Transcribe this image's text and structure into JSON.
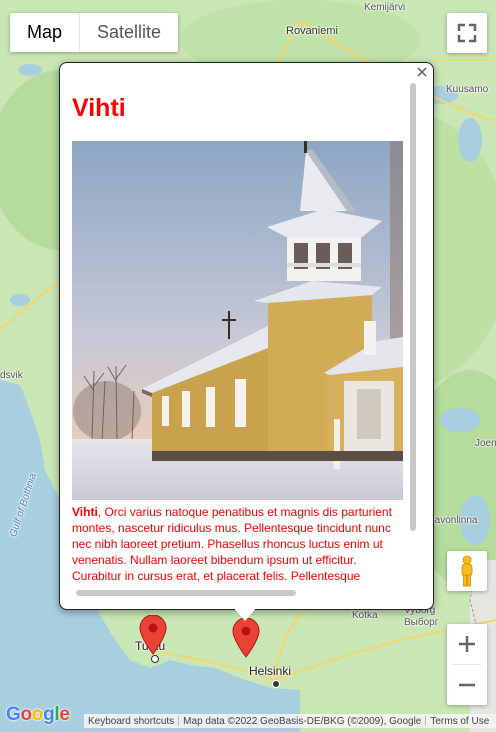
{
  "map": {
    "type_control": {
      "map_label": "Map",
      "satellite_label": "Satellite",
      "selected": "Map"
    },
    "places": {
      "kemijarvi": "Kemijärvi",
      "rovaniemi": "Rovaniemi",
      "kuusamo": "Kuusamo",
      "vaasa_fragment": "dsvik",
      "gulf_of_bothnia": "Gulf of Bothnia",
      "joensuu_fragment": "Joen",
      "savonlinna": "Savonlinna",
      "kotka": "Kotka",
      "vyborg": "Vyborg",
      "vyborg_ru": "Выборг",
      "turku": "Turku",
      "helsinki": "Helsinki"
    },
    "markers": [
      "turku-marker",
      "vihti-marker"
    ]
  },
  "info_window": {
    "title": "Vihti",
    "photo_icon": "wooden-church-photo",
    "text_lead": "Vihti",
    "text_body": ", Orci varius natoque penatibus et magnis dis parturient montes, nascetur ridiculus mus. Pellentesque tincidunt nunc nec nibh laoreet pretium. Phasellus rhoncus luctus enim ut venenatis. Nullam laoreet bibendum ipsum ut efficitur. Curabitur in cursus erat, et",
    "text_cut": "placerat felis. Pellentesque habitant morbi tristique",
    "close_icon": "close-icon"
  },
  "controls": {
    "fullscreen_icon": "fullscreen-icon",
    "pegman_icon": "pegman-icon",
    "zoom_in_icon": "zoom-in-icon",
    "zoom_out_icon": "zoom-out-icon"
  },
  "attribution": {
    "logo": "Google",
    "keyboard": "Keyboard shortcuts",
    "map_data": "Map data ©2022 GeoBasis-DE/BKG (©2009), Google",
    "terms": "Terms of Use"
  },
  "colors": {
    "accent": "#ff0000",
    "land": "#c9e6b5",
    "water": "#a8cfe0",
    "marker": "#ea4335"
  }
}
